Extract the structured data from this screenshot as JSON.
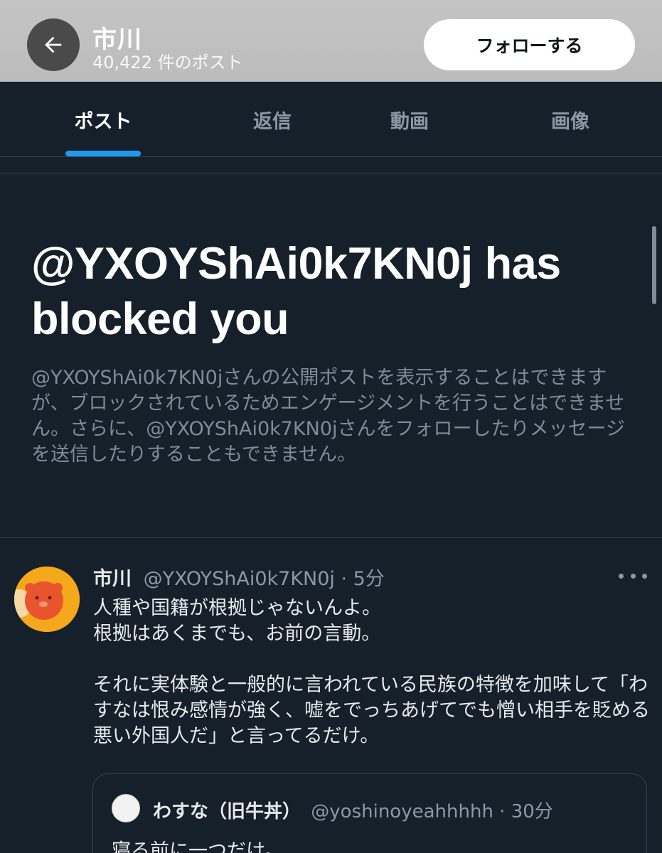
{
  "header": {
    "name": "市川",
    "post_count": "40,422 件のポスト",
    "follow_label": "フォローする"
  },
  "tabs": [
    {
      "label": "ポスト",
      "active": true
    },
    {
      "label": "返信"
    },
    {
      "label": "動画"
    },
    {
      "label": "画像"
    }
  ],
  "blocked": {
    "title": "@YXOYShAi0k7KN0j has blocked you",
    "description": "@YXOYShAi0k7KN0jさんの公開ポストを表示することはできますが、ブロックされているためエンゲージメントを行うことはできません。さらに、@YXOYShAi0k7KN0jさんをフォローしたりメッセージを送信したりすることもできません。"
  },
  "post": {
    "name": "市川",
    "handle_time": "@YXOYShAi0k7KN0j · 5分",
    "text": "人種や国籍が根拠じゃないんよ。\n根拠はあくまでも、お前の言動。\n\nそれに実体験と一般的に言われている民族の特徴を加味して「わすなは恨み感情が強く、嘘をでっちあげてでも憎い相手を貶める悪い外国人だ」と言ってるだけ。",
    "quote": {
      "name": "わすな（旧牛丼）",
      "handle_time": "@yoshinoyeahhhhh · 30分",
      "text": "寝る前に一つだけ。"
    }
  },
  "colors": {
    "background": "#15202b",
    "accent": "#1d9bf0",
    "muted_text": "#8b98a5",
    "border": "#38444d"
  },
  "icons": [
    "back-arrow-icon",
    "more-icon"
  ]
}
